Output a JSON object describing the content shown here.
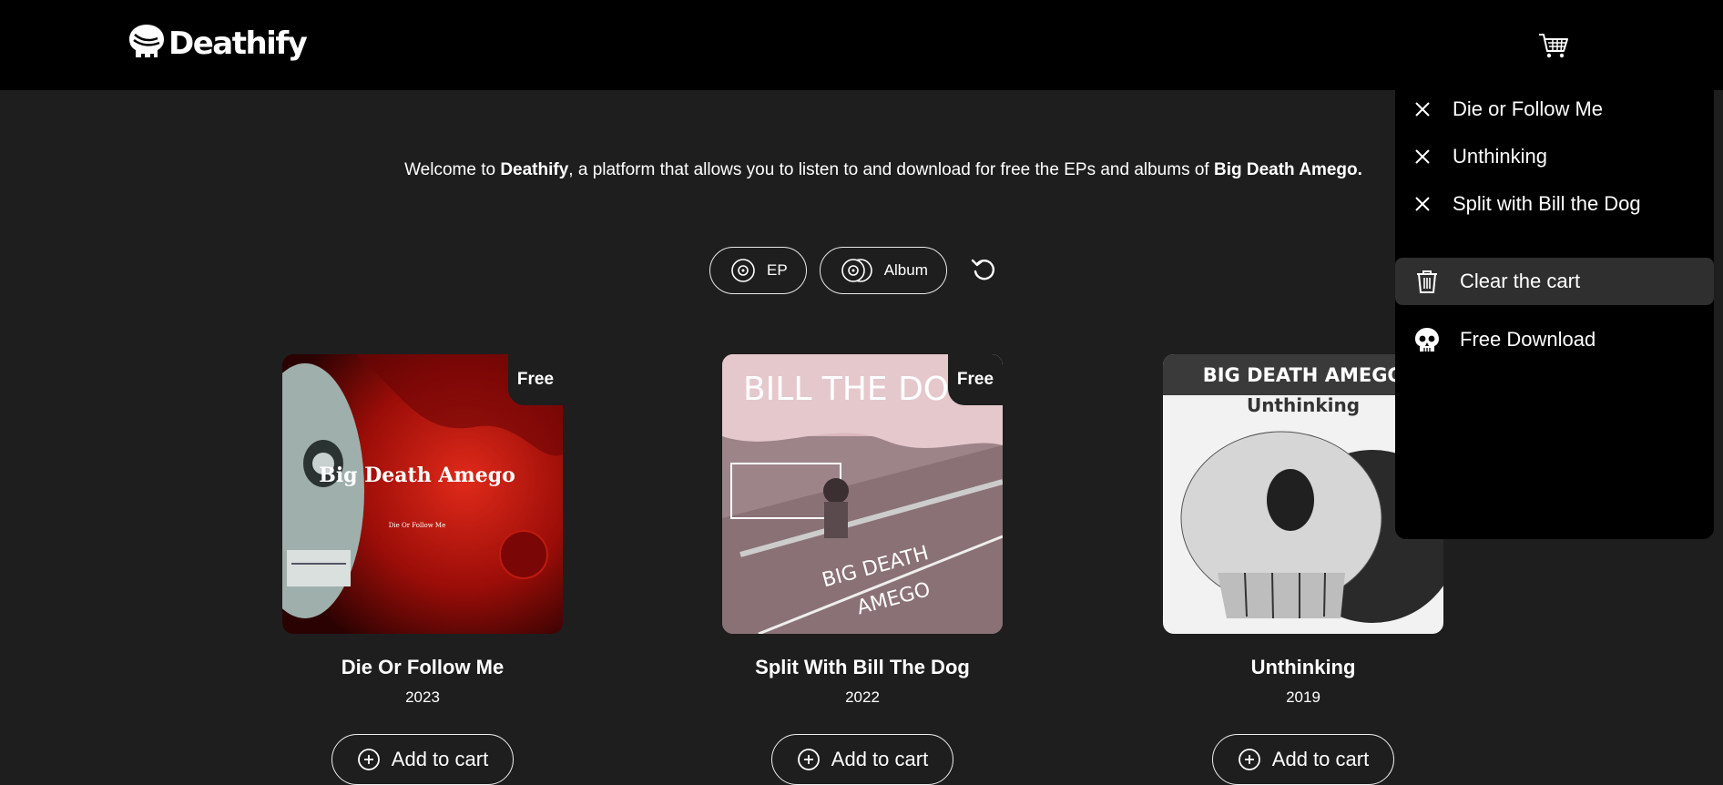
{
  "header": {
    "brand": "Deathify"
  },
  "welcome": {
    "prefix": "Welcome to ",
    "brand": "Deathify",
    "middle": ", a platform that allows you to listen to and download for free the EPs and albums of ",
    "artist": "Big Death Amego."
  },
  "filters": [
    {
      "label": "EP",
      "icon": "disc-icon"
    },
    {
      "label": "Album",
      "icon": "double-disc-icon"
    }
  ],
  "albums": [
    {
      "title": "Die Or Follow Me",
      "year": "2023",
      "badge": "Free",
      "add_label": "Add to cart",
      "cover": {
        "artist": "Big Death Amego",
        "subtitle": "Die Or Follow Me"
      }
    },
    {
      "title": "Split With Bill The Dog",
      "year": "2022",
      "badge": "Free",
      "add_label": "Add to cart",
      "cover": {
        "top": "BILL THE DOG",
        "bottom1": "BIG DEATH",
        "bottom2": "AMEGO"
      }
    },
    {
      "title": "Unthinking",
      "year": "2019",
      "badge": "",
      "add_label": "Add to cart",
      "cover": {
        "artist": "BIG DEATH AMEGO",
        "subtitle": "Unthinking"
      }
    }
  ],
  "cart": {
    "items": [
      "Die or Follow Me",
      "Unthinking",
      "Split with Bill the Dog"
    ],
    "clear_label": "Clear the cart",
    "download_label": "Free Download"
  },
  "colors": {
    "background": "#1e1e1e",
    "header": "#000000",
    "highlight": "#2f2f2f"
  }
}
